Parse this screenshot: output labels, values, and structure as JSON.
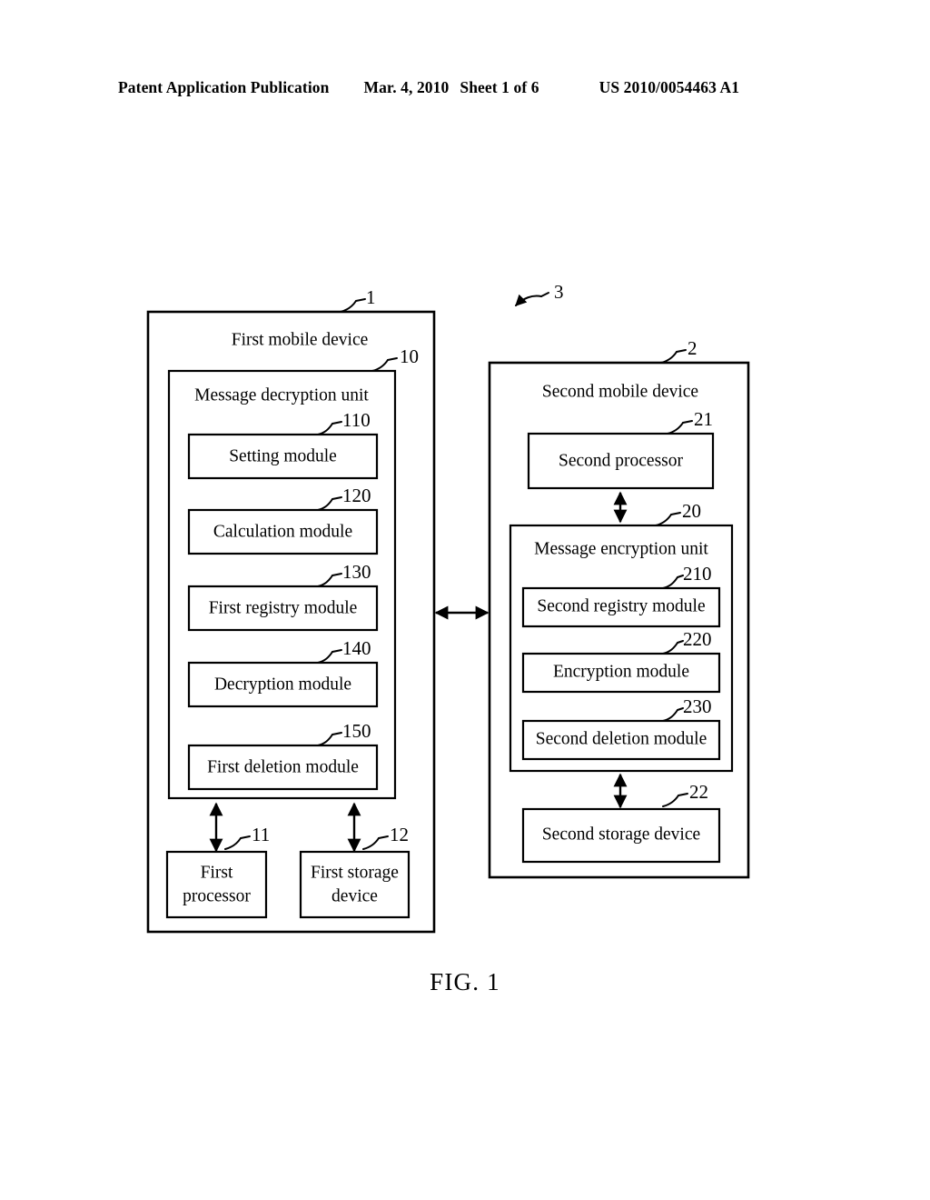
{
  "header": {
    "publication": "Patent Application Publication",
    "date": "Mar. 4, 2010",
    "sheet": "Sheet 1 of 6",
    "patent_number": "US 2010/0054463 A1"
  },
  "figure": {
    "caption": "FIG. 1",
    "system_ref": "3"
  },
  "first_device": {
    "ref": "1",
    "title": "First mobile device",
    "decryption_unit": {
      "ref": "10",
      "title": "Message decryption unit",
      "modules": [
        {
          "ref": "110",
          "label": "Setting module"
        },
        {
          "ref": "120",
          "label": "Calculation module"
        },
        {
          "ref": "130",
          "label": "First registry module"
        },
        {
          "ref": "140",
          "label": "Decryption module"
        },
        {
          "ref": "150",
          "label": "First deletion module"
        }
      ]
    },
    "processor": {
      "ref": "11",
      "line1": "First",
      "line2": "processor"
    },
    "storage": {
      "ref": "12",
      "line1": "First storage",
      "line2": "device"
    }
  },
  "second_device": {
    "ref": "2",
    "title": "Second mobile device",
    "processor": {
      "ref": "21",
      "label": "Second processor"
    },
    "encryption_unit": {
      "ref": "20",
      "title": "Message encryption unit",
      "modules": [
        {
          "ref": "210",
          "label": "Second registry module"
        },
        {
          "ref": "220",
          "label": "Encryption module"
        },
        {
          "ref": "230",
          "label": "Second deletion module"
        }
      ]
    },
    "storage": {
      "ref": "22",
      "label": "Second storage device"
    }
  },
  "colors": {
    "ink": "#000000",
    "paper": "#ffffff"
  }
}
